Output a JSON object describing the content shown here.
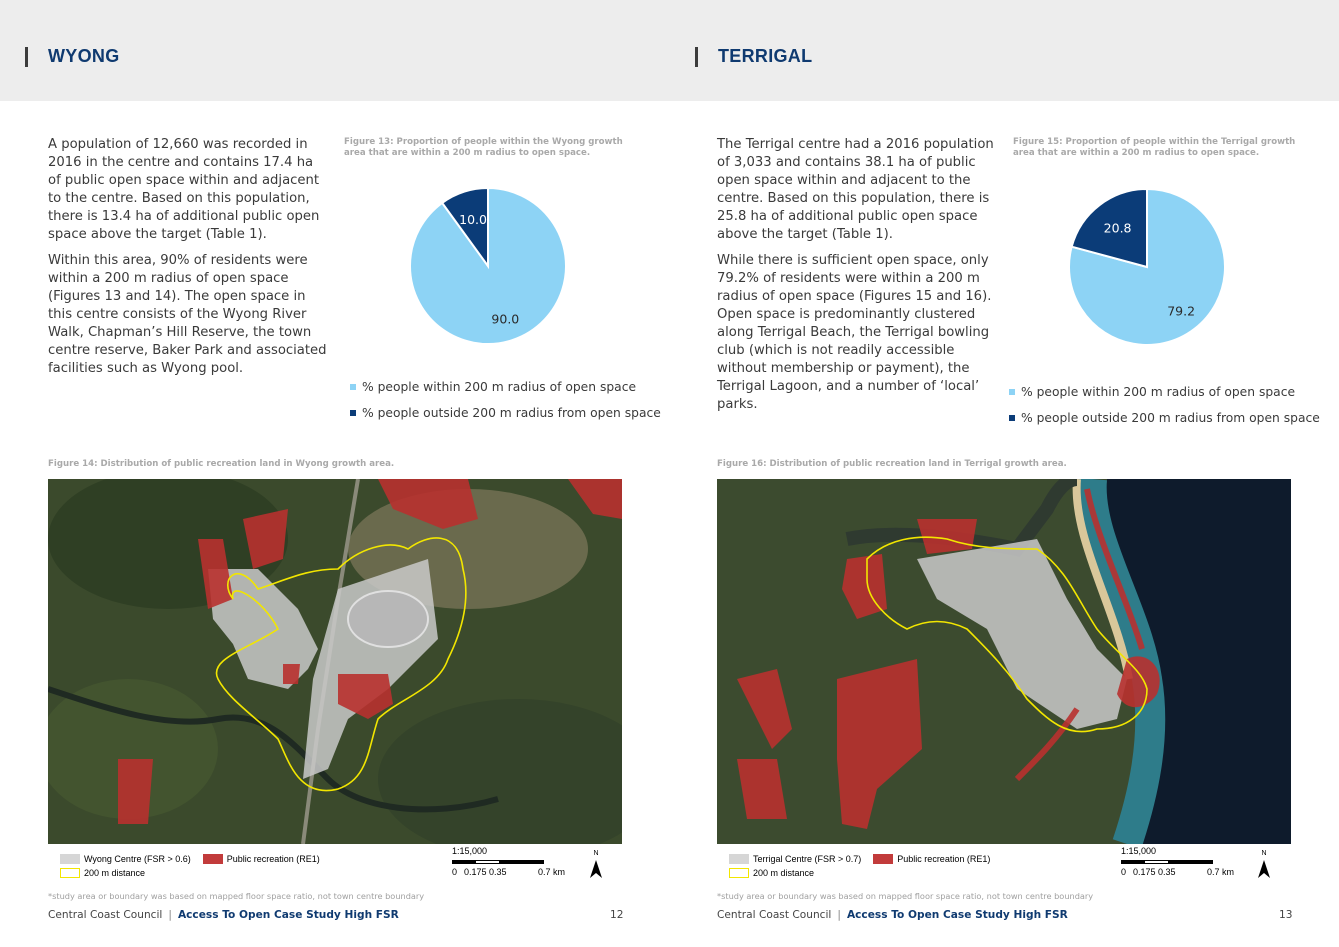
{
  "left": {
    "heading": "WYONG",
    "paragraphs": [
      "A population of 12,660 was recorded in 2016 in the centre and contains 17.4 ha of public open space within and adjacent to the centre. Based on this population, there is 13.4 ha of additional public open space above the target (Table 1).",
      "Within this area, 90% of residents were within a 200 m radius of open space (Figures 13 and 14). The open space in this centre consists of the Wyong River Walk, Chapman’s Hill Reserve, the town centre reserve, Baker Park and associated facilities such as Wyong pool."
    ],
    "figure_caption": "Figure 13: Proportion of people within the Wyong growth area that are within a 200 m radius to open space.",
    "map_caption": "Figure 14: Distribution of public recreation land in Wyong growth area.",
    "map_legend": {
      "centre": "Wyong Centre (FSR > 0.6)",
      "recreation": "Public recreation (RE1)",
      "distance": "200 m distance"
    },
    "scale": {
      "ratio": "1:15,000",
      "t0": "0",
      "t1": "0.175 0.35",
      "t2": "0.7 km"
    },
    "north": "N",
    "footnote": "*study area or boundary was based on mapped floor space ratio, not town centre boundary",
    "footer_org": "Central Coast Council",
    "footer_sep": "|",
    "footer_doc": "Access To Open Case Study High FSR",
    "page": "12"
  },
  "right": {
    "heading": "TERRIGAL",
    "paragraphs": [
      "The Terrigal centre had a 2016 population of 3,033 and contains 38.1 ha of public open space within and adjacent to the centre. Based on this population, there is 25.8 ha of additional public open space above the target (Table 1).",
      "While there is sufficient open space, only 79.2% of residents were within a 200 m radius of open space (Figures 15 and 16). Open space is predominantly clustered along Terrigal Beach, the Terrigal bowling club (which is not readily accessible without membership or payment), the Terrigal Lagoon, and a number of ‘local’ parks."
    ],
    "figure_caption": "Figure 15: Proportion of people within the Terrigal growth area that are within a 200 m radius to open space.",
    "map_caption": "Figure 16: Distribution of public recreation land in Terrigal growth area.",
    "map_legend": {
      "centre": "Terrigal Centre (FSR > 0.7)",
      "recreation": "Public recreation (RE1)",
      "distance": "200 m distance"
    },
    "scale": {
      "ratio": "1:15,000",
      "t0": "0",
      "t1": "0.175 0.35",
      "t2": "0.7 km"
    },
    "north": "N",
    "footnote": "*study area or boundary was based on mapped floor space ratio, not town centre boundary",
    "footer_org": "Central Coast Council",
    "footer_sep": "|",
    "footer_doc": "Access To Open Case Study High FSR",
    "page": "13"
  },
  "colors": {
    "within": "#8dd3f5",
    "outside": "#0b3c78",
    "recreation": "#c23b3b",
    "centre": "#d6d6d6",
    "boundary": "#f2e600",
    "heading": "#0f3a70"
  },
  "chart_data": [
    {
      "type": "pie",
      "title": "Figure 13: Proportion of people within the Wyong growth area that are within a 200 m radius to open space.",
      "categories": [
        "% people within 200 m radius of open space",
        "% people outside 200 m radius from open space"
      ],
      "values": [
        90.0,
        10.0
      ],
      "labels": [
        "90.0",
        "10.0"
      ],
      "colors": [
        "#8dd3f5",
        "#0b3c78"
      ],
      "legend": "bottom"
    },
    {
      "type": "pie",
      "title": "Figure 15: Proportion of people within the Terrigal growth area that are within a 200 m radius to open space.",
      "categories": [
        "% people within 200 m radius of open space",
        "% people outside 200 m radius from open space"
      ],
      "values": [
        79.2,
        20.8
      ],
      "labels": [
        "79.2",
        "20.8"
      ],
      "colors": [
        "#8dd3f5",
        "#0b3c78"
      ],
      "legend": "bottom"
    }
  ]
}
